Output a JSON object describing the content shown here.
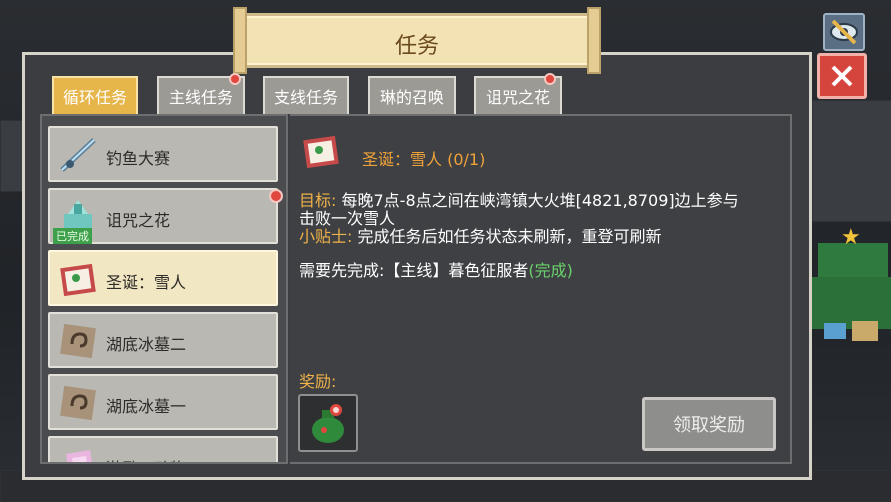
{
  "title": "任务",
  "tabs": [
    {
      "label": "循环任务",
      "active": true,
      "has_dot": false
    },
    {
      "label": "主线任务",
      "active": false,
      "has_dot": true
    },
    {
      "label": "支线任务",
      "active": false,
      "has_dot": false
    },
    {
      "label": "琳的召唤",
      "active": false,
      "has_dot": false
    },
    {
      "label": "诅咒之花",
      "active": false,
      "has_dot": true
    }
  ],
  "quests": [
    {
      "label": "钓鱼大赛",
      "icon": "fishing-rod-icon",
      "done": false,
      "has_dot": false
    },
    {
      "label": "诅咒之花",
      "icon": "crystal-flower-icon",
      "done": true,
      "has_dot": true
    },
    {
      "label": "圣诞：雪人",
      "icon": "christmas-card-icon",
      "done": false,
      "has_dot": false,
      "active": true
    },
    {
      "label": "湖底冰墓二",
      "icon": "rune-stone-icon",
      "done": false,
      "has_dot": false
    },
    {
      "label": "湖底冰墓一",
      "icon": "rune-stone-icon",
      "done": false,
      "has_dot": false
    },
    {
      "label": "激励：动物",
      "icon": "pink-crystal-icon",
      "done": false,
      "has_dot": false
    }
  ],
  "done_badge": "已完成",
  "detail": {
    "title": "圣诞：雪人 (0/1)",
    "goal_label": "目标:",
    "goal_text": " 每晚7点-8点之间在峡湾镇大火堆[4821,8709]边上参与",
    "goal_text2": "击败一次雪人",
    "tip_label": "小贴士:",
    "tip_text": " 完成任务后如任务状态未刷新，重登可刷新",
    "prereq_text": "需要先完成:【主线】暮色征服者",
    "prereq_status": "(完成)",
    "reward_label": "奖励:",
    "claim_button": "领取奖励"
  },
  "colors": {
    "accent_orange": "#f0a23a",
    "tab_active": "#e6b64b",
    "done_green": "#6bd36b",
    "close_red": "#d6443e"
  }
}
